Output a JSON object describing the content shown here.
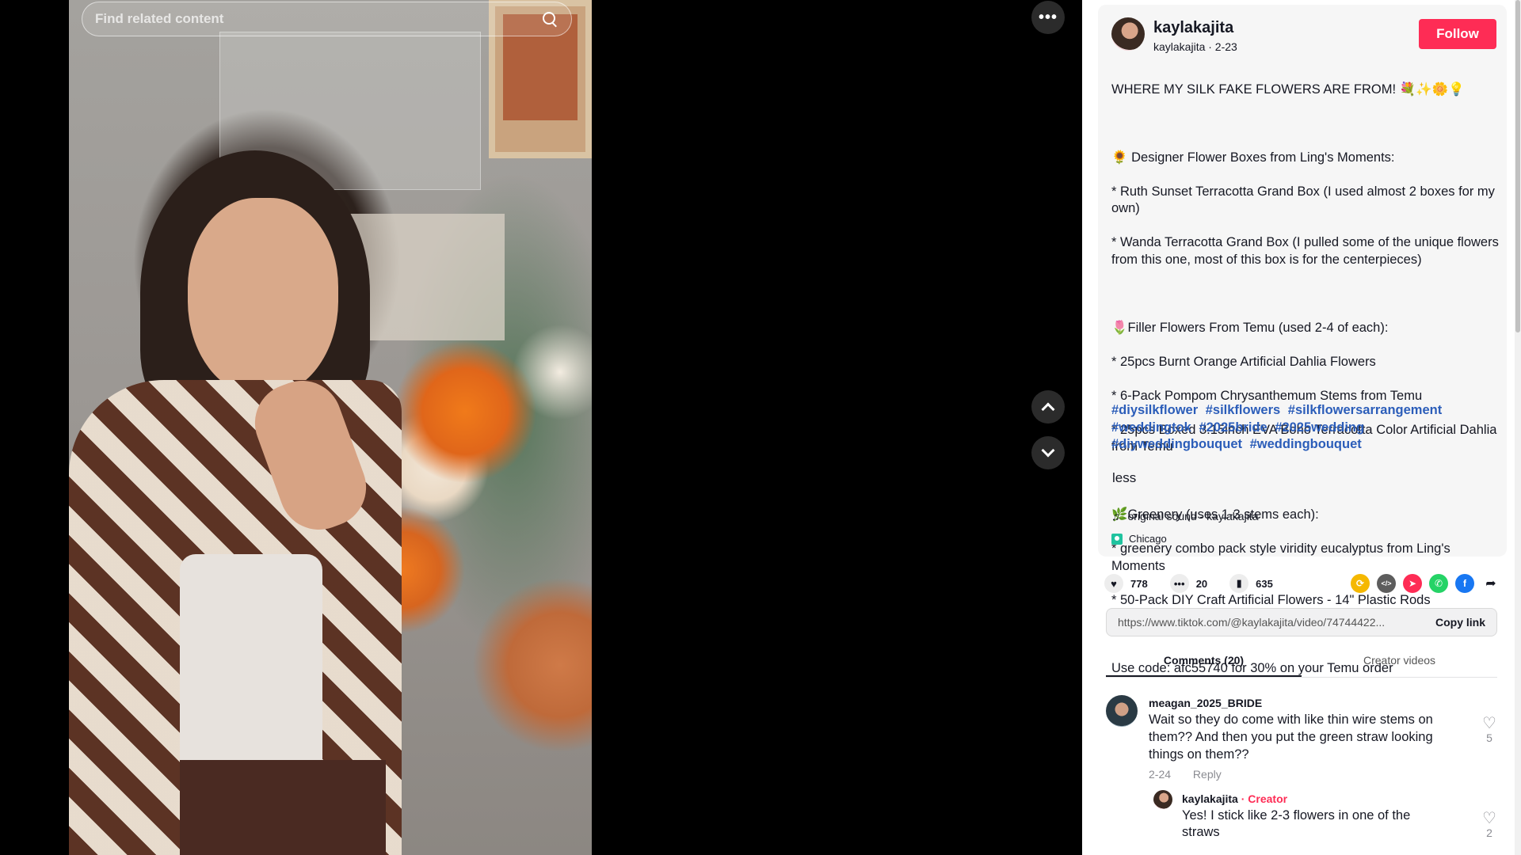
{
  "search": {
    "placeholder": "Find related content"
  },
  "video_controls": {
    "more_glyph": "•••"
  },
  "author": {
    "name": "kaylakajita",
    "handle_date": "kaylakajita · 2-23",
    "follow_label": "Follow"
  },
  "description": {
    "lines": [
      "WHERE MY SILK FAKE FLOWERS ARE FROM! 💐✨🌼💡",
      "",
      "🌻 Designer Flower Boxes from Ling's Moments:",
      "* Ruth Sunset Terracotta Grand Box (I used almost 2 boxes for my own)",
      "* Wanda Terracotta Grand Box (I pulled some of the unique flowers from this one, most of this box is for the centerpieces)",
      "",
      "🌷Filler Flowers From Temu (used 2-4 of each):",
      "* 25pcs Burnt Orange Artificial Dahlia Flowers",
      "* 6-Pack Pompom Chrysanthemum Stems from Temu",
      "* 25pcs Boxed 3.15inch EVA Boho Terracotta Color Artificial Dahlia from Temu",
      "",
      "🌿Greenery (uses 1-3 stems each):",
      "* greenery combo pack style viridity eucalyptus from Ling's Moments",
      "* 50-Pack DIY Craft Artificial Flowers - 14\" Plastic Rods",
      "",
      "Use code: afc55740 for 30% on your Temu order"
    ],
    "hashtags": [
      "#diysilkflower",
      "#silkflowers",
      "#silkflowersarrangement",
      "#weddingtok",
      "#2025bride",
      "#2025wedding",
      "#diyweddingbouquet",
      "#weddingbouquet"
    ],
    "less_label": "less"
  },
  "sound": {
    "icon": "♫",
    "label": "original sound - kaylakajita"
  },
  "location": {
    "label": "Chicago"
  },
  "actions": {
    "likes": "778",
    "comments": "20",
    "saves": "635"
  },
  "share_icons": [
    {
      "name": "repost",
      "color": "#f5b800",
      "glyph": "⟳"
    },
    {
      "name": "embed",
      "color": "#5d5d5d",
      "glyph": "</>"
    },
    {
      "name": "send",
      "color": "#fe2c55",
      "glyph": "➤"
    },
    {
      "name": "whatsapp",
      "color": "#25d366",
      "glyph": "✆"
    },
    {
      "name": "facebook",
      "color": "#1877f2",
      "glyph": "f"
    },
    {
      "name": "share-arrow",
      "color": "#ffffff",
      "glyph": "➦"
    }
  ],
  "link": {
    "url": "https://www.tiktok.com/@kaylakajita/video/74744422...",
    "copy_label": "Copy link"
  },
  "tabs": [
    {
      "label": "Comments (20)",
      "active": true
    },
    {
      "label": "Creator videos",
      "active": false
    }
  ],
  "comments": [
    {
      "user": "meagan_2025_BRIDE",
      "text": "Wait so they do come with like thin wire stems on them?? And then you put the green straw looking things on them??",
      "date": "2-24",
      "reply_label": "Reply",
      "likes": "5"
    }
  ],
  "reply": {
    "user": "kaylakajita",
    "creator_tag": "· Creator",
    "text": "Yes! I stick like 2-3 flowers in one of the straws",
    "likes": "2"
  }
}
